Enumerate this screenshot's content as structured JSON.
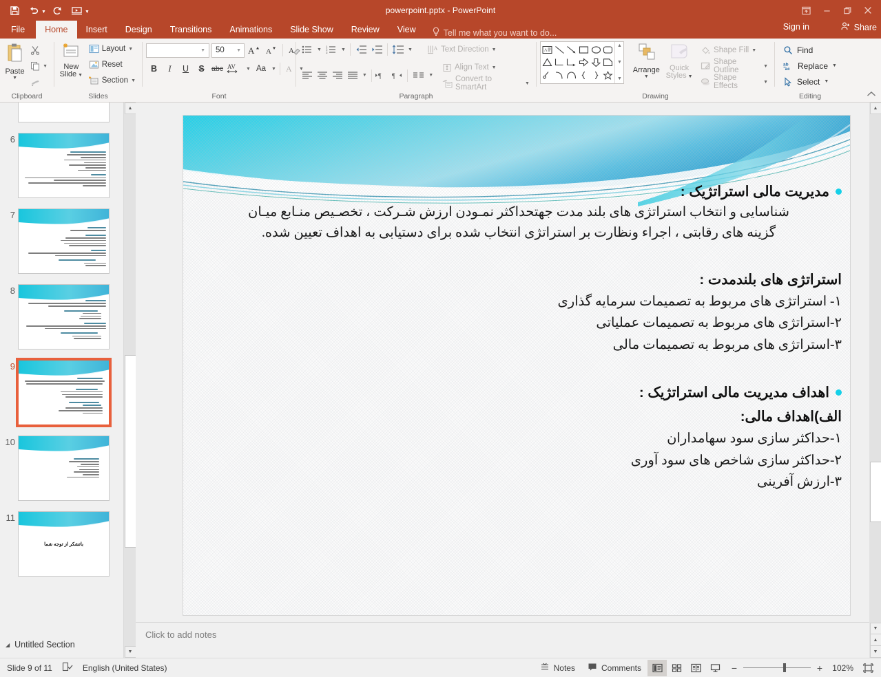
{
  "window": {
    "title": "powerpoint.pptx - PowerPoint",
    "quick_access": [
      {
        "name": "save-icon",
        "label": "Save"
      },
      {
        "name": "undo-icon",
        "label": "Undo"
      },
      {
        "name": "redo-icon",
        "label": "Redo"
      },
      {
        "name": "start-from-beginning-icon",
        "label": "Start From Beginning"
      },
      {
        "name": "customize-quick-access-toolbar-icon",
        "label": "Customize Quick Access Toolbar"
      }
    ],
    "controls": {
      "ribbon_display_options": "Ribbon Display Options",
      "minimize": "Minimize",
      "restore": "Restore Down",
      "close": "Close"
    }
  },
  "tabs": [
    {
      "label": "File",
      "active": false
    },
    {
      "label": "Home",
      "active": true
    },
    {
      "label": "Insert",
      "active": false
    },
    {
      "label": "Design",
      "active": false
    },
    {
      "label": "Transitions",
      "active": false
    },
    {
      "label": "Animations",
      "active": false
    },
    {
      "label": "Slide Show",
      "active": false
    },
    {
      "label": "Review",
      "active": false
    },
    {
      "label": "View",
      "active": false
    }
  ],
  "tellme": {
    "placeholder": "Tell me what you want to do..."
  },
  "account": {
    "signin": "Sign in",
    "share": "Share"
  },
  "ribbon": {
    "clipboard": {
      "label": "Clipboard",
      "paste": "Paste",
      "cut": "Cut",
      "copy": "Copy",
      "format_painter": "Format Painter"
    },
    "slides": {
      "label": "Slides",
      "new_slide": "New\nSlide",
      "new_slide_line1": "New",
      "new_slide_line2": "Slide",
      "layout": "Layout",
      "reset": "Reset",
      "section": "Section"
    },
    "font": {
      "label": "Font",
      "font_name": "",
      "font_size": "50",
      "increase_font": "Increase Font Size",
      "decrease_font": "Decrease Font Size",
      "clear_formatting": "Clear All Formatting",
      "bold": "B",
      "italic": "I",
      "underline": "U",
      "shadow": "S",
      "strikethrough": "abc",
      "character_spacing": "AV",
      "change_case": "Aa",
      "font_color": "A"
    },
    "paragraph": {
      "label": "Paragraph",
      "text_direction": "Text Direction",
      "align_text": "Align Text",
      "convert_to_smartart": "Convert to SmartArt"
    },
    "drawing": {
      "label": "Drawing",
      "arrange": "Arrange",
      "quick_styles_line1": "Quick",
      "quick_styles_line2": "Styles",
      "shape_fill": "Shape Fill",
      "shape_outline": "Shape Outline",
      "shape_effects": "Shape Effects"
    },
    "editing": {
      "label": "Editing",
      "find": "Find",
      "replace": "Replace",
      "select": "Select"
    },
    "collapse": "Collapse the Ribbon"
  },
  "thumbnails": [
    {
      "number": "5",
      "selected": false,
      "lines": [],
      "partial": true
    },
    {
      "number": "6",
      "selected": false,
      "lines": [
        0.4,
        0.48,
        0.3,
        0.52,
        0.26,
        0.46,
        0.24,
        0.34,
        0.0,
        0.22,
        0.96,
        0.64,
        0.92,
        0.3
      ]
    },
    {
      "number": "7",
      "selected": false,
      "lines": [
        0.24,
        0.44,
        0.0,
        0.26,
        0.5,
        0.56,
        0.52,
        0.46,
        0.0,
        0.2,
        0.94,
        0.62,
        0.0,
        0.46,
        0.28,
        0.26
      ]
    },
    {
      "number": "8",
      "selected": false,
      "lines": [
        0.26,
        0.92,
        0.7,
        0.0,
        0.44,
        0.22,
        0.24,
        0.26,
        0.0,
        0.28,
        0.96,
        0.74,
        0.0,
        0.46,
        0.36,
        0.34
      ]
    },
    {
      "number": "9",
      "selected": true,
      "lines": [
        0.3,
        0.94,
        0.92,
        0.0,
        0.28,
        0.5,
        0.48,
        0.46,
        0.0,
        0.36,
        0.22,
        0.44,
        0.52,
        0.24
      ]
    },
    {
      "number": "10",
      "selected": false,
      "lines": [
        0.3,
        0.36,
        0.22,
        0.26,
        0.24,
        0.3,
        0.2,
        0.38
      ]
    },
    {
      "number": "11",
      "selected": false,
      "lines": [],
      "center_text": "باتشكر از توجه شما"
    }
  ],
  "section": {
    "triangle": "collapse",
    "name": "Untitled Section"
  },
  "slide": {
    "heading1": "مدیریت مالی استراتژیک :",
    "paragraph1_line1": "شناسایی و انتخاب استراتژی های بلند مدت جهتحداکثر نمـودن ارزش شـرکت ، تخصـیص منـابع میـان",
    "paragraph1_line2": "گزینه های رقابتی ، اجراء ونظارت بر استراتژی انتخاب شده برای دستیابی به اهداف تعیین شده.",
    "heading2": "استراتژی های بلندمدت :",
    "items1": [
      "۱- استراتژی های مربوط به تصمیمات سرمایه گذاری",
      "۲-استراتژی های مربوط به تصمیمات عملیاتی",
      "۳-استراتژی های مربوط به تصمیمات مالی"
    ],
    "heading3": "اهداف مدیریت مالی استراتژیک :",
    "heading4": "الف)اهداف مالی:",
    "items2": [
      "۱-حداکثر سازی سود سهامداران",
      "۲-حداکثر سازی شاخص های سود آوری",
      "۳-ارزش آفرینی"
    ],
    "bullet_color": "#15d0e8"
  },
  "notes": {
    "placeholder": "Click to add notes"
  },
  "status": {
    "slide_counter": "Slide 9 of 11",
    "spellcheck": "Spell check",
    "language": "English (United States)",
    "notes": "Notes",
    "comments": "Comments",
    "views": [
      {
        "name": "normal-view",
        "label": "Normal",
        "active": true
      },
      {
        "name": "slide-sorter-view",
        "label": "Slide Sorter",
        "active": false
      },
      {
        "name": "reading-view",
        "label": "Reading View",
        "active": false
      },
      {
        "name": "slide-show-view",
        "label": "Slide Show",
        "active": false
      }
    ],
    "zoom_out": "−",
    "zoom_in": "+",
    "zoom_value": "102%",
    "fit_slide": "Fit slide to current window"
  },
  "colors": {
    "ribbon_accent": "#b7472a",
    "selected_thumb": "#e8603c",
    "bullet": "#15d0e8"
  }
}
